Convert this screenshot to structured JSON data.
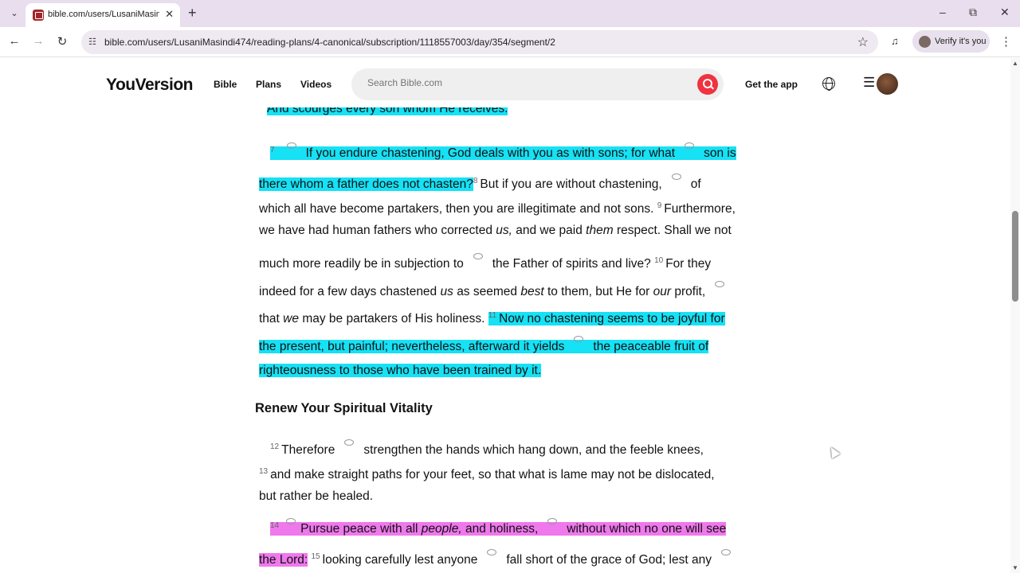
{
  "browser": {
    "tab_title": "bible.com/users/LusaniMasindi",
    "url": "bible.com/users/LusaniMasindi474/reading-plans/4-canonical/subscription/1118557003/day/354/segment/2",
    "verify_label": "Verify it's you",
    "icons": [
      "tab-list-icon",
      "favicon-icon",
      "close-icon",
      "plus-icon",
      "minimize-icon",
      "restore-icon",
      "window-close-icon",
      "back-icon",
      "forward-icon",
      "reload-icon",
      "site-info-icon",
      "star-icon",
      "media-icon",
      "kebab-icon"
    ]
  },
  "header": {
    "logo": "YouVersion",
    "nav": [
      "Bible",
      "Plans",
      "Videos"
    ],
    "search_placeholder": "Search Bible.com",
    "get_app": "Get the app",
    "colors": {
      "search_button": "#ef3340"
    }
  },
  "reading": {
    "highlight_colors": {
      "cyan": "#16e1f5",
      "pink": "#ef78ec"
    },
    "lines": {
      "l0": "And scourges every son whom He receives.",
      "l1a_num": "7",
      "l1a": "If you endure chastening, God deals with you as with sons; for what",
      "l1b": "son is",
      "l2a": "there whom a father does not chasten?",
      "l2_num": "8",
      "l2b": "But if you are without chastening,",
      "l2c": "of",
      "l3a": "which all have become partakers, then you are illegitimate and not sons.",
      "l3_num": "9",
      "l3b": "Furthermore,",
      "l4a": "we have had human fathers who corrected",
      "l4_us": "us,",
      "l4b": "and we paid",
      "l4_them": "them",
      "l4c": "respect. Shall we not",
      "l5a": "much more readily be in subjection to",
      "l5b": "the Father of spirits and live?",
      "l5_num": "10",
      "l5c": "For they",
      "l6a": "indeed for a few days chastened",
      "l6_us": "us",
      "l6b": "as seemed",
      "l6_best": "best",
      "l6c": "to them, but He for",
      "l6_our": "our",
      "l6d": "profit,",
      "l7a": "that",
      "l7_we": "we",
      "l7b": "may be partakers of His holiness.",
      "l7_num": "11",
      "l7c": "Now no chastening seems to be joyful for",
      "l8a": "the present, but painful; nevertheless, afterward it yields",
      "l8b": "the peaceable fruit of",
      "l9": "righteousness to those who have been trained by it.",
      "heading": "Renew Your Spiritual Vitality",
      "l10_num": "12",
      "l10a": "Therefore",
      "l10b": "strengthen the hands which hang down, and the feeble knees,",
      "l11_num": "13",
      "l11": "and make straight paths for your feet, so that what is lame may not be dislocated,",
      "l12": "but rather be healed.",
      "l13_num": "14",
      "l13a": "Pursue peace with all",
      "l13_people": "people,",
      "l13b": "and holiness,",
      "l13c": "without which no one will see",
      "l14a": "the Lord:",
      "l14_num": "15",
      "l14b": "looking carefully lest anyone",
      "l14c": "fall short of the grace of God; lest any"
    }
  }
}
